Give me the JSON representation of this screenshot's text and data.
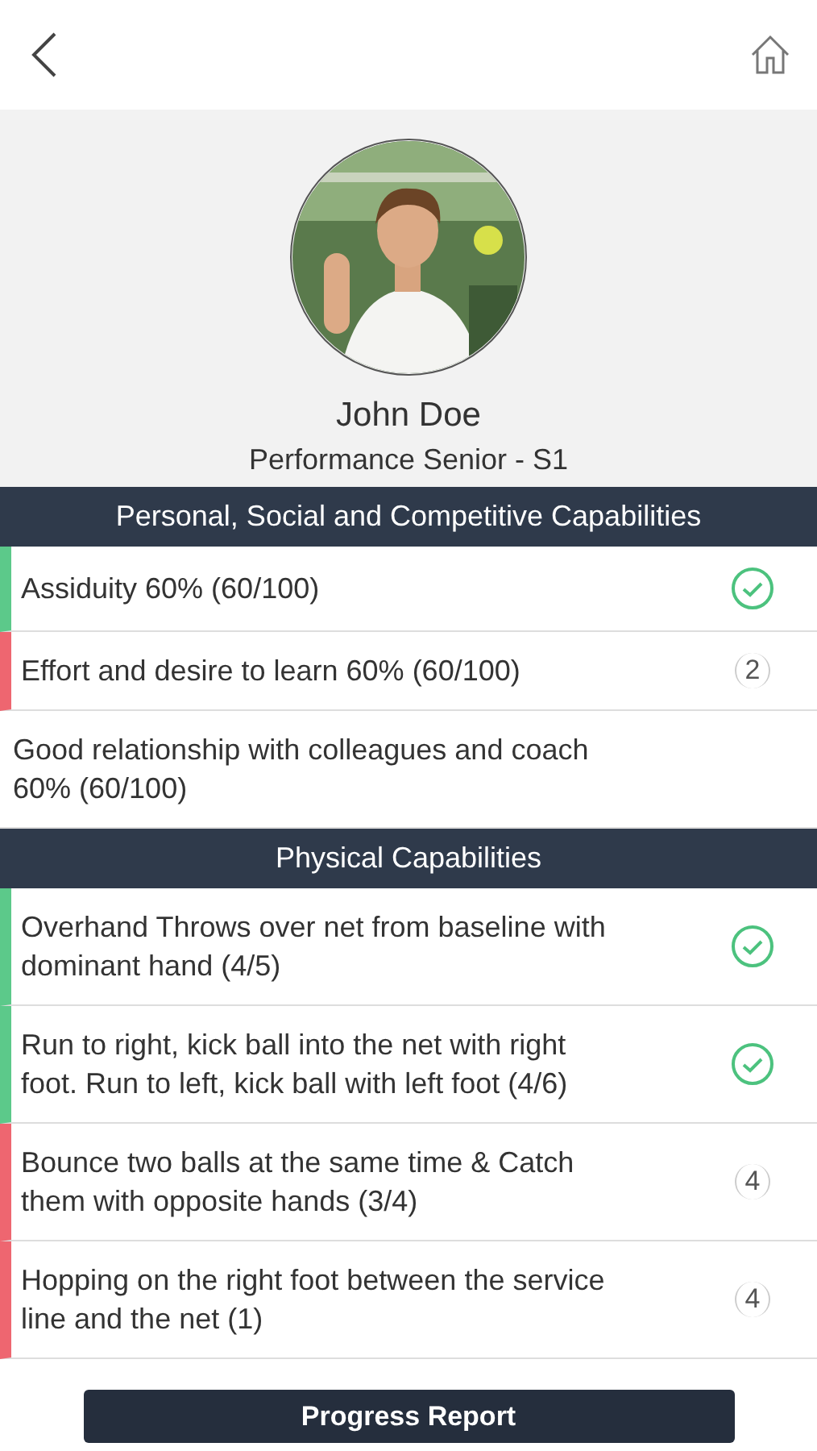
{
  "profile": {
    "name": "John Doe",
    "subtitle": "Performance Senior - S1"
  },
  "sections": [
    {
      "title": "Personal, Social and Competitive Capabilities",
      "items": [
        {
          "text": "Assiduity 60% (60/100)",
          "kind": "done"
        },
        {
          "text": "Effort and desire to learn 60% (60/100)",
          "kind": "pending",
          "count": "2"
        },
        {
          "text": "Good relationship with colleagues and coach 60% (60/100)",
          "kind": "none"
        }
      ]
    },
    {
      "title": "Physical Capabilities",
      "items": [
        {
          "text": "Overhand Throws over net from baseline with dominant hand  (4/5)",
          "kind": "done"
        },
        {
          "text": "Run to right, kick ball into the net with right foot. Run to left, kick ball with left foot (4/6)",
          "kind": "done"
        },
        {
          "text": "Bounce two balls at the same time & Catch them with opposite hands (3/4)",
          "kind": "pending",
          "count": "4"
        },
        {
          "text": "Hopping on the right foot between the service line and the net (1)",
          "kind": "pending",
          "count": "4"
        }
      ]
    }
  ],
  "button": "Progress Report"
}
